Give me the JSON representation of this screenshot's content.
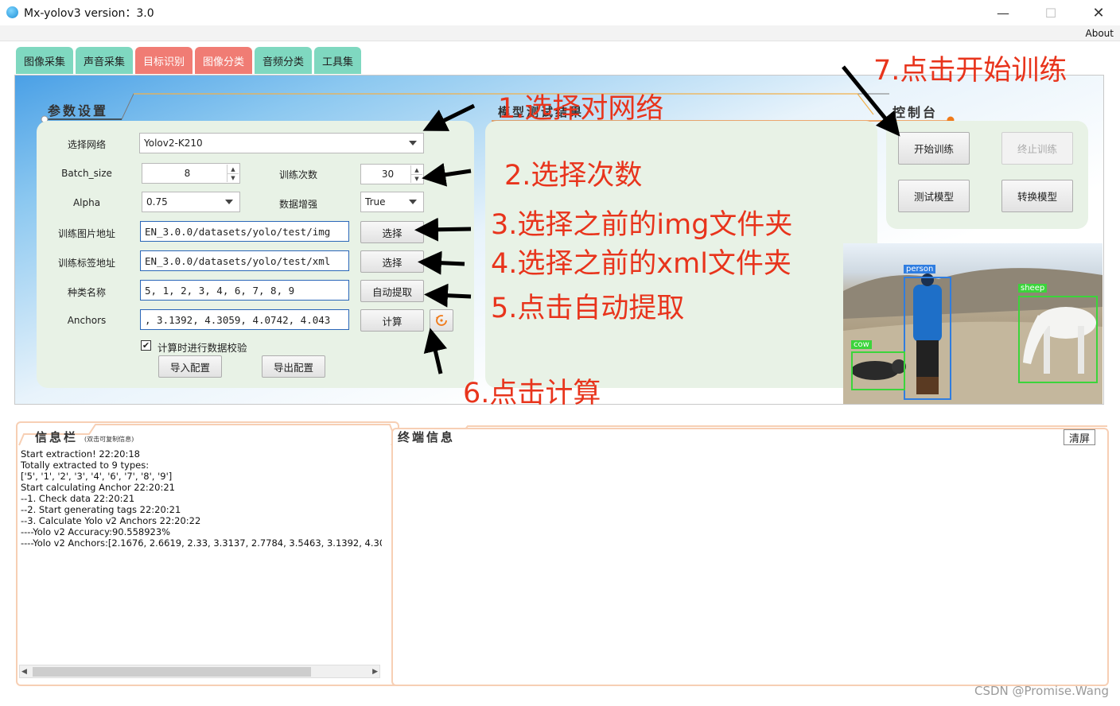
{
  "window": {
    "title": "Mx-yolov3 version：3.0",
    "minimize": "—",
    "maximize": "☐",
    "close": "✕",
    "about": "About"
  },
  "tabs": [
    {
      "label": "图像采集",
      "color": "#7fd8c0"
    },
    {
      "label": "声音采集",
      "color": "#7fd8c0"
    },
    {
      "label": "目标识别",
      "color": "#f07c74"
    },
    {
      "label": "图像分类",
      "color": "#f07c74"
    },
    {
      "label": "音频分类",
      "color": "#7fd8c0"
    },
    {
      "label": "工具集",
      "color": "#7fd8c0"
    }
  ],
  "params": {
    "section_title": "参数设置",
    "network_label": "选择网络",
    "network_value": "Yolov2-K210",
    "batch_label": "Batch_size",
    "batch_value": "8",
    "epochs_label": "训练次数",
    "epochs_value": "30",
    "alpha_label": "Alpha",
    "alpha_value": "0.75",
    "augment_label": "数据增强",
    "augment_value": "True",
    "img_dir_label": "训练图片地址",
    "img_dir_value": "EN_3.0.0/datasets/yolo/test/img",
    "xml_dir_label": "训练标签地址",
    "xml_dir_value": "EN_3.0.0/datasets/yolo/test/xml",
    "classes_label": "种类名称",
    "classes_value": "5, 1, 2, 3, 4, 6, 7, 8, 9",
    "anchors_label": "Anchors",
    "anchors_value": ", 3.1392, 4.3059, 4.0742, 4.043",
    "select_btn": "选择",
    "auto_extract_btn": "自动提取",
    "compute_btn": "计算",
    "validate_checkbox": "计算时进行数据校验",
    "import_btn": "导入配置",
    "export_btn": "导出配置"
  },
  "results": {
    "section_title": "模型测试结果"
  },
  "console": {
    "section_title": "控制台",
    "start_btn": "开始训练",
    "stop_btn": "终止训练",
    "test_btn": "测试模型",
    "convert_btn": "转换模型"
  },
  "detections": [
    {
      "label": "person",
      "color": "#2f7de0"
    },
    {
      "label": "sheep",
      "color": "#3bd43b"
    },
    {
      "label": "cow",
      "color": "#3bd43b"
    }
  ],
  "annotations": [
    "1.选择对网络",
    "2.选择次数",
    "3.选择之前的img文件夹",
    "4.选择之前的xml文件夹",
    "5.点击自动提取",
    "6.点击计算",
    "7.点击开始训练"
  ],
  "info": {
    "title": "信息栏",
    "subtitle": "(双击可复制信息)",
    "lines": [
      "Start extraction!  22:20:18",
      "Totally extracted to 9 types:",
      "['5', '1', '2', '3', '4', '6', '7', '8', '9']",
      "Start calculating Anchor  22:20:21",
      "--1. Check data  22:20:21",
      "--2. Start generating tags  22:20:21",
      "--3. Calculate Yolo v2 Anchors  22:20:22",
      "  ----Yolo v2 Accuracy:90.558923%",
      "  ----Yolo v2 Anchors:[2.1676, 2.6619, 2.33, 3.3137, 2.7784, 3.5463, 3.1392, 4.30"
    ]
  },
  "terminal": {
    "title": "终端信息",
    "clear_btn": "清屏"
  },
  "watermark": "CSDN @Promise.Wang",
  "colors": {
    "annotation": "#e8341c",
    "tab_teal": "#7fd8c0",
    "tab_red": "#f07c74",
    "panel_green": "#e8f2e6",
    "accent_orange": "#f07a1a"
  }
}
